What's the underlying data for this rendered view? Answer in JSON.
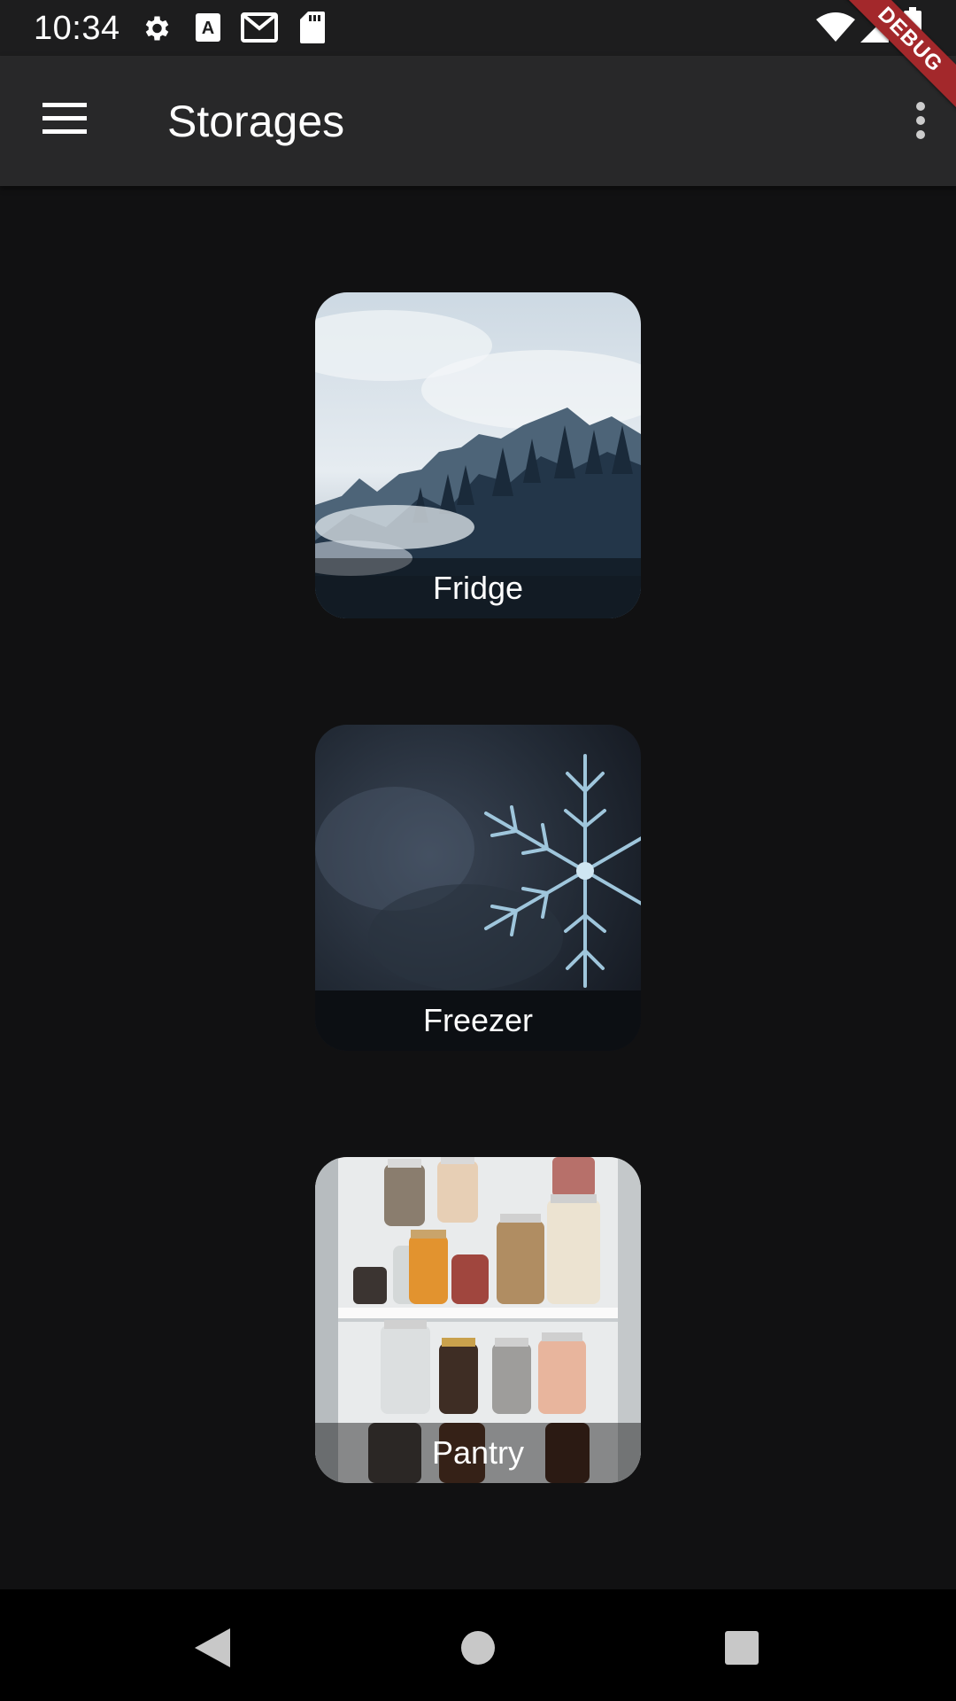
{
  "status_bar": {
    "time": "10:34",
    "left_icons": [
      "settings-icon",
      "keyboard-a-icon",
      "gmail-icon",
      "sd-card-icon"
    ],
    "right_icons": [
      "wifi-icon",
      "cellular-icon",
      "battery-icon"
    ]
  },
  "app_bar": {
    "title": "Storages",
    "menu_icon": "hamburger-menu-icon",
    "overflow_icon": "more-vert-icon"
  },
  "debug_banner": "DEBUG",
  "storages": [
    {
      "label": "Fridge",
      "image": "misty-forest"
    },
    {
      "label": "Freezer",
      "image": "snowflake"
    },
    {
      "label": "Pantry",
      "image": "pantry-jars"
    }
  ],
  "nav_bar": {
    "buttons": [
      "back-icon",
      "home-icon",
      "recents-icon"
    ]
  },
  "colors": {
    "background": "#111112",
    "app_bar": "#282829",
    "status_bar": "#1d1d1e",
    "debug_banner": "#a3282b"
  }
}
